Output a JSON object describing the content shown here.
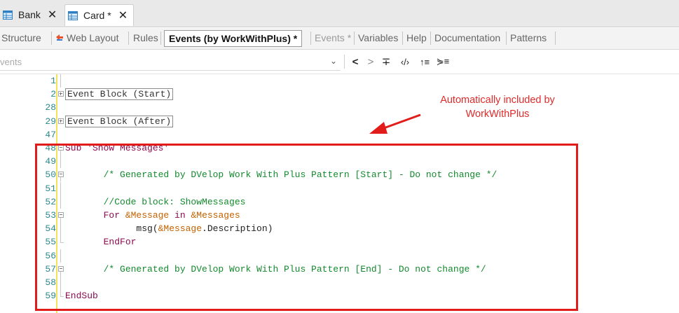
{
  "doc_tabs": [
    {
      "label": "Bank",
      "close": "✕",
      "icon": "table-icon",
      "active": false
    },
    {
      "label": "Card *",
      "close": "✕",
      "icon": "table-icon",
      "active": true
    }
  ],
  "object_tabs": [
    {
      "label": "Structure"
    },
    {
      "label": "Web Layout",
      "icon": "web-layout-icon"
    },
    {
      "label": "Rules"
    },
    {
      "label": "Events (by WorkWithPlus) *",
      "selected": true
    },
    {
      "label": "Events *"
    },
    {
      "label": "Variables"
    },
    {
      "label": "Help"
    },
    {
      "label": "Documentation"
    },
    {
      "label": "Patterns"
    }
  ],
  "toolbar": {
    "combo_value": "vents",
    "buttons": [
      {
        "name": "prev-event-button",
        "glyph": "<"
      },
      {
        "name": "next-event-button",
        "glyph": ">"
      },
      {
        "name": "collapse-button",
        "glyph": "∓"
      },
      {
        "name": "code-tags-button",
        "glyph": "‹/›"
      },
      {
        "name": "sort-button",
        "glyph": "↑≡"
      },
      {
        "name": "outline-button",
        "glyph": "⋟≡"
      }
    ]
  },
  "editor": {
    "lines": [
      {
        "num": "1",
        "fold": "line",
        "parts": []
      },
      {
        "num": "2",
        "fold": "plus",
        "parts": [
          {
            "t": "Event Block (Start)",
            "c": "block"
          }
        ]
      },
      {
        "num": "28",
        "fold": "none",
        "parts": []
      },
      {
        "num": "29",
        "fold": "plus",
        "parts": [
          {
            "t": "Event Block (After)",
            "c": "block"
          }
        ]
      },
      {
        "num": "47",
        "fold": "none",
        "parts": []
      },
      {
        "num": "48",
        "fold": "minus",
        "parts": [
          {
            "t": "Sub 'Show Messages'",
            "c": "k"
          }
        ]
      },
      {
        "num": "49",
        "fold": "line",
        "parts": []
      },
      {
        "num": "50",
        "fold": "minus",
        "parts": [
          {
            "t": "       /* Generated by DVelop Work With Plus Pattern [Start] - Do not change */",
            "c": "cm"
          }
        ]
      },
      {
        "num": "51",
        "fold": "line",
        "parts": []
      },
      {
        "num": "52",
        "fold": "line",
        "parts": [
          {
            "t": "       //Code block: ShowMessages",
            "c": "cm"
          }
        ]
      },
      {
        "num": "53",
        "fold": "minus",
        "parts": [
          {
            "t": "       For ",
            "c": "k"
          },
          {
            "t": "&Message",
            "c": "vr"
          },
          {
            "t": " in ",
            "c": "k"
          },
          {
            "t": "&Messages",
            "c": "vr"
          }
        ]
      },
      {
        "num": "54",
        "fold": "line",
        "parts": [
          {
            "t": "             msg(",
            "c": "pl"
          },
          {
            "t": "&Message",
            "c": "vr"
          },
          {
            "t": ".Description)",
            "c": "pl"
          }
        ]
      },
      {
        "num": "55",
        "fold": "end",
        "parts": [
          {
            "t": "       EndFor",
            "c": "k"
          }
        ]
      },
      {
        "num": "56",
        "fold": "line",
        "parts": []
      },
      {
        "num": "57",
        "fold": "minus",
        "parts": [
          {
            "t": "       /* Generated by DVelop Work With Plus Pattern [End] - Do not change */",
            "c": "cm"
          }
        ]
      },
      {
        "num": "58",
        "fold": "line",
        "parts": []
      },
      {
        "num": "59",
        "fold": "end",
        "parts": [
          {
            "t": "EndSub",
            "c": "k"
          }
        ]
      }
    ]
  },
  "annotation": {
    "line1": "Automatically included by",
    "line2": "WorkWithPlus"
  },
  "colors": {
    "annotation_red": "#e21b1b",
    "keyword": "#8b0a50",
    "comment": "#138a2d",
    "variable": "#c46200",
    "line_number": "#2b8a91",
    "gutter_change": "#f4e25c"
  }
}
